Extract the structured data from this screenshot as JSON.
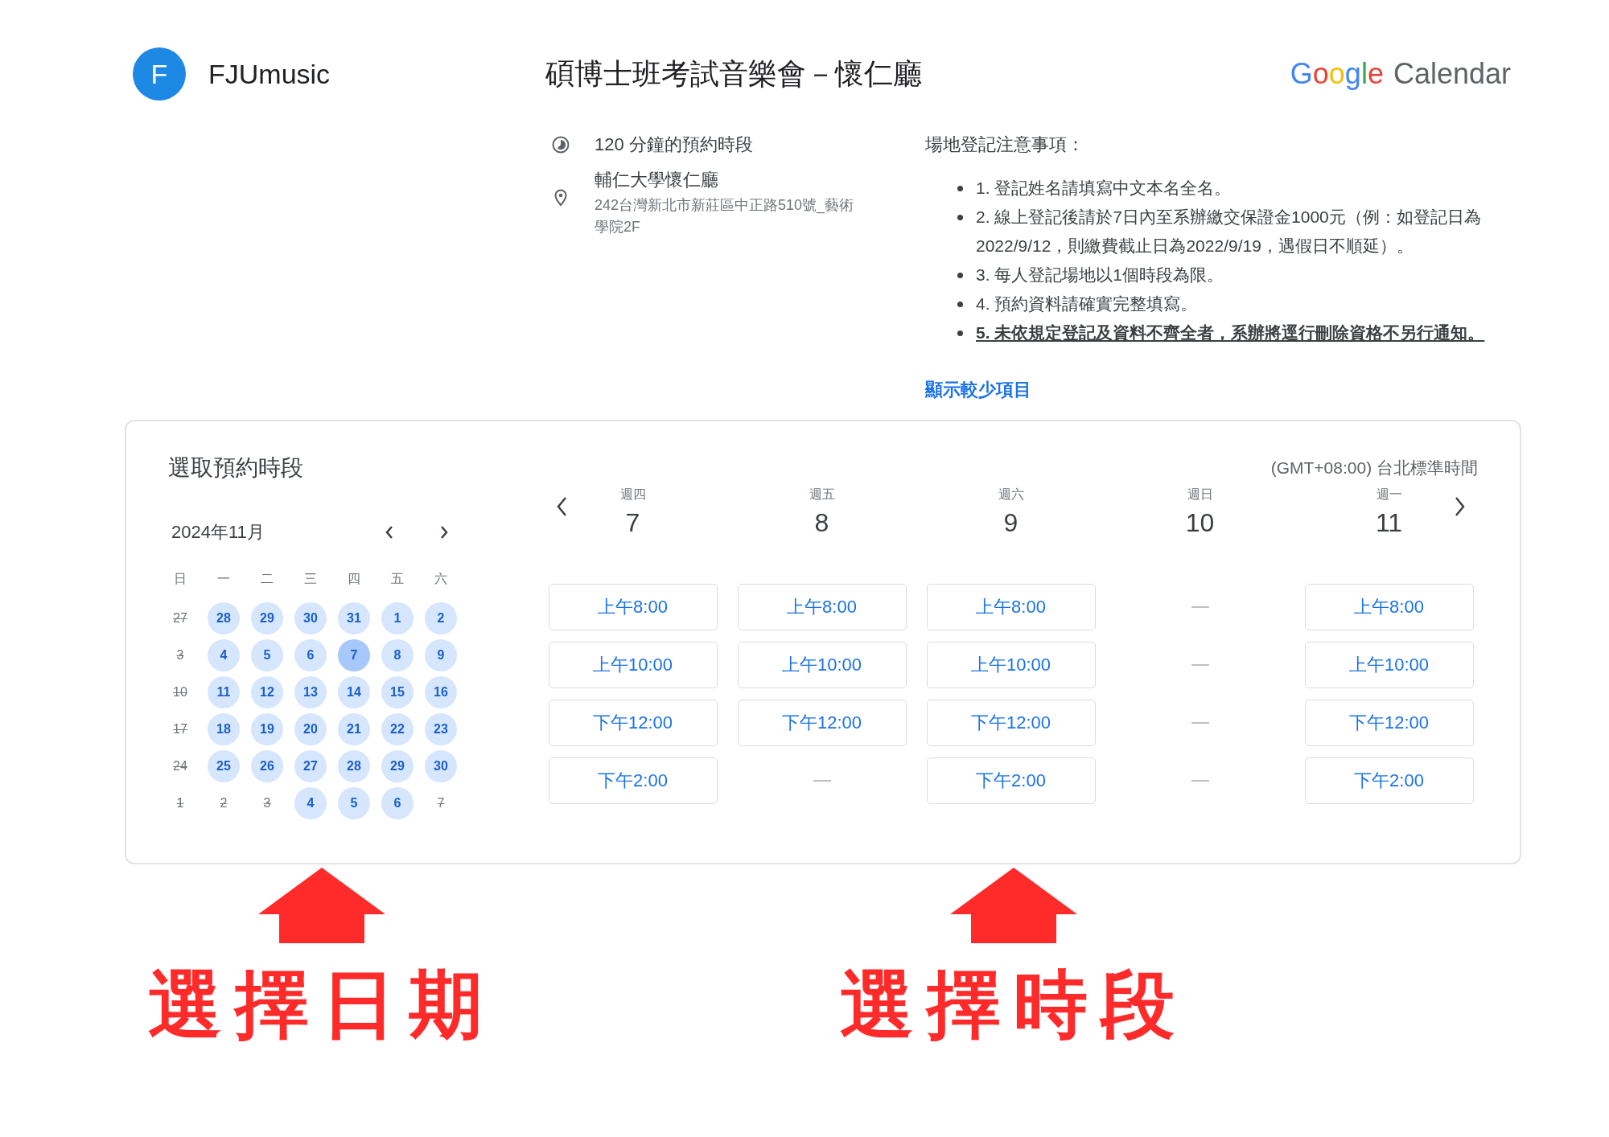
{
  "header": {
    "avatar_letter": "F",
    "organizer": "FJUmusic",
    "title": "碩博士班考試音樂會－懷仁廳",
    "logo_word": "Google",
    "logo_product": "Calendar"
  },
  "details": {
    "duration": "120 分鐘的預約時段",
    "location_name": "輔仁大學懷仁廳",
    "location_address": "242台灣新北市新莊區中正路510號_藝術學院2F"
  },
  "notes": {
    "title": "場地登記注意事項：",
    "items": [
      {
        "kind": "plain",
        "text": "1. 登記姓名請填寫中文本名全名。"
      },
      {
        "kind": "plain",
        "text": "2. 線上登記後請於7日內至系辦繳交保證金1000元（例：如登記日為2022/9/12，則繳費截止日為2022/9/19，遇假日不順延）。"
      },
      {
        "kind": "plain",
        "text": "3. 每人登記場地以1個時段為限。"
      },
      {
        "kind": "plain",
        "text": "4. 預約資料請確實完整填寫。"
      },
      {
        "kind": "warning",
        "text": "5. 未依規定登記及資料不齊全者，系辦將逕行刪除資格不另行通知。"
      }
    ],
    "toggle": "顯示較少項目"
  },
  "booking": {
    "title": "選取預約時段",
    "timezone": "(GMT+08:00) 台北標準時間",
    "month": "2024年11月",
    "weekdays": [
      "日",
      "一",
      "二",
      "三",
      "四",
      "五",
      "六"
    ],
    "days": [
      {
        "label": "27",
        "available": false,
        "selected": false
      },
      {
        "label": "28",
        "available": true,
        "selected": false
      },
      {
        "label": "29",
        "available": true,
        "selected": false
      },
      {
        "label": "30",
        "available": true,
        "selected": false
      },
      {
        "label": "31",
        "available": true,
        "selected": false
      },
      {
        "label": "1",
        "available": true,
        "selected": false
      },
      {
        "label": "2",
        "available": true,
        "selected": false
      },
      {
        "label": "3",
        "available": false,
        "selected": false
      },
      {
        "label": "4",
        "available": true,
        "selected": false
      },
      {
        "label": "5",
        "available": true,
        "selected": false
      },
      {
        "label": "6",
        "available": true,
        "selected": false
      },
      {
        "label": "7",
        "available": true,
        "selected": true
      },
      {
        "label": "8",
        "available": true,
        "selected": false
      },
      {
        "label": "9",
        "available": true,
        "selected": false
      },
      {
        "label": "10",
        "available": false,
        "selected": false
      },
      {
        "label": "11",
        "available": true,
        "selected": false
      },
      {
        "label": "12",
        "available": true,
        "selected": false
      },
      {
        "label": "13",
        "available": true,
        "selected": false
      },
      {
        "label": "14",
        "available": true,
        "selected": false
      },
      {
        "label": "15",
        "available": true,
        "selected": false
      },
      {
        "label": "16",
        "available": true,
        "selected": false
      },
      {
        "label": "17",
        "available": false,
        "selected": false
      },
      {
        "label": "18",
        "available": true,
        "selected": false
      },
      {
        "label": "19",
        "available": true,
        "selected": false
      },
      {
        "label": "20",
        "available": true,
        "selected": false
      },
      {
        "label": "21",
        "available": true,
        "selected": false
      },
      {
        "label": "22",
        "available": true,
        "selected": false
      },
      {
        "label": "23",
        "available": true,
        "selected": false
      },
      {
        "label": "24",
        "available": false,
        "selected": false
      },
      {
        "label": "25",
        "available": true,
        "selected": false
      },
      {
        "label": "26",
        "available": true,
        "selected": false
      },
      {
        "label": "27",
        "available": true,
        "selected": false
      },
      {
        "label": "28",
        "available": true,
        "selected": false
      },
      {
        "label": "29",
        "available": true,
        "selected": false
      },
      {
        "label": "30",
        "available": true,
        "selected": false
      },
      {
        "label": "1",
        "available": false,
        "selected": false
      },
      {
        "label": "2",
        "available": false,
        "selected": false
      },
      {
        "label": "3",
        "available": false,
        "selected": false
      },
      {
        "label": "4",
        "available": true,
        "selected": false
      },
      {
        "label": "5",
        "available": true,
        "selected": false
      },
      {
        "label": "6",
        "available": true,
        "selected": false
      },
      {
        "label": "7",
        "available": false,
        "selected": false
      }
    ],
    "columns": [
      {
        "weekday": "週四",
        "day": "7",
        "slots": [
          {
            "kind": "time",
            "label": "上午8:00"
          },
          {
            "kind": "time",
            "label": "上午10:00"
          },
          {
            "kind": "time",
            "label": "下午12:00"
          },
          {
            "kind": "time",
            "label": "下午2:00"
          }
        ]
      },
      {
        "weekday": "週五",
        "day": "8",
        "slots": [
          {
            "kind": "time",
            "label": "上午8:00"
          },
          {
            "kind": "time",
            "label": "上午10:00"
          },
          {
            "kind": "time",
            "label": "下午12:00"
          },
          {
            "kind": "none"
          }
        ]
      },
      {
        "weekday": "週六",
        "day": "9",
        "slots": [
          {
            "kind": "time",
            "label": "上午8:00"
          },
          {
            "kind": "time",
            "label": "上午10:00"
          },
          {
            "kind": "time",
            "label": "下午12:00"
          },
          {
            "kind": "time",
            "label": "下午2:00"
          }
        ]
      },
      {
        "weekday": "週日",
        "day": "10",
        "slots": [
          {
            "kind": "none"
          },
          {
            "kind": "none"
          },
          {
            "kind": "none"
          },
          {
            "kind": "none"
          }
        ]
      },
      {
        "weekday": "週一",
        "day": "11",
        "slots": [
          {
            "kind": "time",
            "label": "上午8:00"
          },
          {
            "kind": "time",
            "label": "上午10:00"
          },
          {
            "kind": "time",
            "label": "下午12:00"
          },
          {
            "kind": "time",
            "label": "下午2:00"
          }
        ]
      }
    ]
  },
  "annotations": [
    {
      "label": "選擇日期"
    },
    {
      "label": "選擇時段"
    }
  ]
}
